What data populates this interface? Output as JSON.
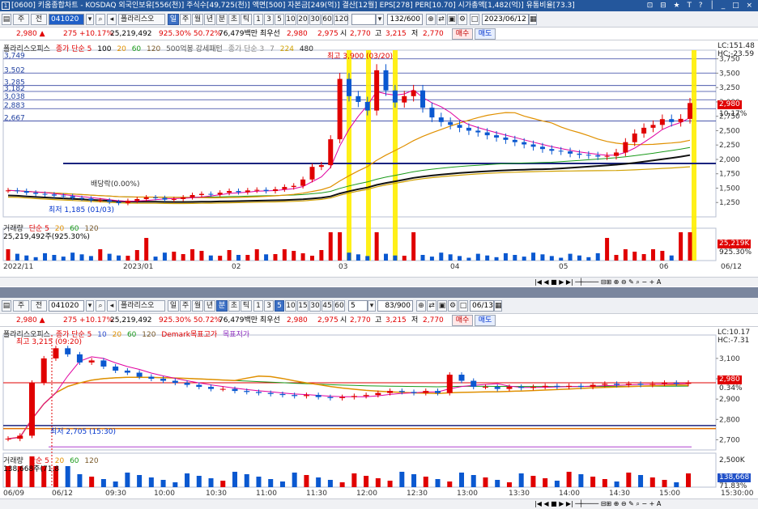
{
  "window": {
    "title": "[0600] 키움종합차트 - KOSDAQ 외국인보유[556(천)] 주식수[49,725(천)] 액면[500] 자본금[249(억)] 결산[12월] EPS[278] PER[10.70] 시가총액[1,482(억)] 유통비율[73.3]",
    "controls": "⊡ ⊟ ★ T ? │ _ □ ×"
  },
  "top": {
    "toolbar": {
      "tab1": "주",
      "tab2": "전",
      "code": "041020",
      "name": "폴라리스오",
      "periods": [
        "일",
        "주",
        "월",
        "년",
        "분",
        "초",
        "틱"
      ],
      "period_active": "일",
      "minutes": [
        "1",
        "3",
        "5",
        "10",
        "20",
        "30",
        "60",
        "120"
      ],
      "count": "132/600",
      "date": "2023/06/12"
    },
    "quote": {
      "price": "2,980 ▲",
      "change": "275 +10.17%",
      "volume": "25,219,492",
      "vol_ratio": "925.30% 50.72%",
      "amount": "76,479백만 최우선",
      "bid1": "2,980",
      "bid2": "2,975",
      "open_l": "시",
      "open": "2,770",
      "high_l": "고",
      "high": "3,215",
      "low_l": "저",
      "low": "2,770",
      "buy": "매수",
      "sell": "매도"
    },
    "legend": [
      "폴라리스오피스",
      "종가 단순 5",
      "100",
      "20",
      "60",
      "120",
      "500억봉 강세패턴",
      "종가 단순 3",
      "7",
      "224",
      "480"
    ],
    "y_labels": [
      "3,750",
      "3,500",
      "3,250",
      "3,000",
      "2,750",
      "2,500",
      "2,250",
      "2,000",
      "1,750",
      "1,500",
      "1,250"
    ],
    "left_levels": [
      "3,749",
      "3,502",
      "3,285",
      "3,182",
      "3,038",
      "2,883",
      "2,667"
    ],
    "lc": "LC:151.48",
    "hc": "HC:-23.59",
    "last_tag": "2,980",
    "last_pct": "10.17%",
    "annot_high": "최고 3,900 (03/20)",
    "annot_low": "최저 1,185 (01/03)",
    "annot_div": "배당락(0.00%)",
    "vol_legend": [
      "거래량",
      "단순 5",
      "20",
      "60",
      "120"
    ],
    "vol_value": "25,219,492주(925.30%)",
    "vol_tag": "25,219K",
    "vol_pct": "925.30%",
    "x_labels": [
      "2022/11",
      "2023/01",
      "02",
      "03",
      "04",
      "05",
      "06",
      "06/12"
    ],
    "chart_data": {
      "type": "candlestick",
      "title": "폴라리스오피스 일봉",
      "x": [
        "2022/11",
        "2023/01",
        "02",
        "03",
        "04",
        "05",
        "06",
        "06/12"
      ],
      "ylim": [
        1000,
        3900
      ],
      "close": [
        1460,
        1450,
        1420,
        1400,
        1390,
        1370,
        1360,
        1330,
        1320,
        1290,
        1290,
        1260,
        1240,
        1280,
        1310,
        1340,
        1330,
        1300,
        1310,
        1340,
        1380,
        1400,
        1390,
        1420,
        1450,
        1430,
        1460,
        1470,
        1450,
        1480,
        1520,
        1540,
        1650,
        1870,
        1900,
        2350,
        3400,
        3100,
        3000,
        2850,
        3550,
        3200,
        2990,
        3100,
        3200,
        2900,
        2730,
        2650,
        2600,
        2550,
        2500,
        2470,
        2420,
        2380,
        2340,
        2300,
        2260,
        2220,
        2180,
        2150,
        2140,
        2100,
        2080,
        2070,
        2050,
        2060,
        2120,
        2300,
        2450,
        2550,
        2600,
        2700,
        2650,
        2705,
        2980
      ]
    }
  },
  "bottom": {
    "toolbar": {
      "tab1": "주",
      "tab2": "전",
      "code": "041020",
      "name": "폴라리스오",
      "periods": [
        "일",
        "주",
        "월",
        "년",
        "분",
        "초",
        "틱"
      ],
      "period_active": "분",
      "minutes": [
        "1",
        "3",
        "5",
        "10",
        "15",
        "30",
        "45",
        "60"
      ],
      "interval": "5",
      "count": "83/900",
      "date": "06/13"
    },
    "quote": {
      "price": "2,980 ▲",
      "change": "275 +10.17%",
      "volume": "25,219,492",
      "vol_ratio": "925.30% 50.72%",
      "amount": "76,479백만 최우선",
      "bid1": "2,980",
      "bid2": "2,975",
      "open_l": "시",
      "open": "2,770",
      "high_l": "고",
      "high": "3,215",
      "low_l": "저",
      "low": "2,770",
      "buy": "매수",
      "sell": "매도"
    },
    "legend": [
      "폴라리스오피스",
      "종가 단순 5",
      "10",
      "20",
      "60",
      "120",
      "Demark목표고가",
      "목표저가"
    ],
    "y_labels": [
      "3,100",
      "3,000",
      "2,900",
      "2,800",
      "2,700"
    ],
    "lc": "LC:10.17",
    "hc": "HC:-7.31",
    "last_tag": "2,980",
    "last_pct": "0.34%",
    "annot_high": "최고 3,215 (09:20)",
    "annot_low": "최저 2,705 (15:30)",
    "vol_legend": [
      "거래량",
      "단순 5",
      "20",
      "60",
      "120"
    ],
    "vol_value": "138,668주(71.8",
    "vol_ylabel": "2,500K",
    "vol_tag": "138,668",
    "vol_pct": "71.83%",
    "x_labels": [
      "06/09",
      "06/12",
      "09:30",
      "10:00",
      "10:30",
      "11:00",
      "11:30",
      "12:00",
      "12:30",
      "13:00",
      "13:30",
      "14:00",
      "14:30",
      "15:00",
      "15:30:00"
    ],
    "chart_data": {
      "type": "candlestick",
      "title": "폴라리스오피스 5분봉",
      "ylim": [
        2650,
        3215
      ],
      "close": [
        2705,
        2720,
        2980,
        3100,
        3150,
        3120,
        3080,
        3090,
        3060,
        3040,
        3030,
        3010,
        3000,
        2990,
        2980,
        2970,
        2960,
        2950,
        2950,
        2940,
        2935,
        2930,
        2925,
        2920,
        2915,
        2920,
        2910,
        2905,
        2910,
        2915,
        2920,
        2930,
        2940,
        2935,
        2930,
        2940,
        2930,
        3020,
        2990,
        2960,
        2960,
        2950,
        2960,
        2955,
        2960,
        2965,
        2960,
        2965,
        2960,
        2970,
        2975,
        2970,
        2975,
        2970,
        2975,
        2980,
        2975,
        2980
      ]
    }
  }
}
